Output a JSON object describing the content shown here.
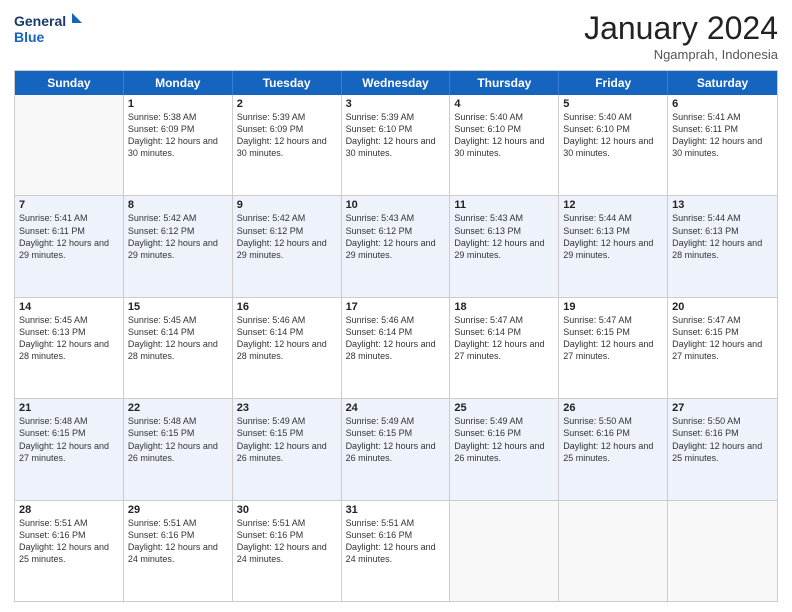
{
  "logo": {
    "line1": "General",
    "line2": "Blue"
  },
  "title": "January 2024",
  "subtitle": "Ngamprah, Indonesia",
  "days": [
    "Sunday",
    "Monday",
    "Tuesday",
    "Wednesday",
    "Thursday",
    "Friday",
    "Saturday"
  ],
  "rows": [
    [
      {
        "day": "",
        "sunrise": "",
        "sunset": "",
        "daylight": ""
      },
      {
        "day": "1",
        "sunrise": "Sunrise: 5:38 AM",
        "sunset": "Sunset: 6:09 PM",
        "daylight": "Daylight: 12 hours and 30 minutes."
      },
      {
        "day": "2",
        "sunrise": "Sunrise: 5:39 AM",
        "sunset": "Sunset: 6:09 PM",
        "daylight": "Daylight: 12 hours and 30 minutes."
      },
      {
        "day": "3",
        "sunrise": "Sunrise: 5:39 AM",
        "sunset": "Sunset: 6:10 PM",
        "daylight": "Daylight: 12 hours and 30 minutes."
      },
      {
        "day": "4",
        "sunrise": "Sunrise: 5:40 AM",
        "sunset": "Sunset: 6:10 PM",
        "daylight": "Daylight: 12 hours and 30 minutes."
      },
      {
        "day": "5",
        "sunrise": "Sunrise: 5:40 AM",
        "sunset": "Sunset: 6:10 PM",
        "daylight": "Daylight: 12 hours and 30 minutes."
      },
      {
        "day": "6",
        "sunrise": "Sunrise: 5:41 AM",
        "sunset": "Sunset: 6:11 PM",
        "daylight": "Daylight: 12 hours and 30 minutes."
      }
    ],
    [
      {
        "day": "7",
        "sunrise": "Sunrise: 5:41 AM",
        "sunset": "Sunset: 6:11 PM",
        "daylight": "Daylight: 12 hours and 29 minutes."
      },
      {
        "day": "8",
        "sunrise": "Sunrise: 5:42 AM",
        "sunset": "Sunset: 6:12 PM",
        "daylight": "Daylight: 12 hours and 29 minutes."
      },
      {
        "day": "9",
        "sunrise": "Sunrise: 5:42 AM",
        "sunset": "Sunset: 6:12 PM",
        "daylight": "Daylight: 12 hours and 29 minutes."
      },
      {
        "day": "10",
        "sunrise": "Sunrise: 5:43 AM",
        "sunset": "Sunset: 6:12 PM",
        "daylight": "Daylight: 12 hours and 29 minutes."
      },
      {
        "day": "11",
        "sunrise": "Sunrise: 5:43 AM",
        "sunset": "Sunset: 6:13 PM",
        "daylight": "Daylight: 12 hours and 29 minutes."
      },
      {
        "day": "12",
        "sunrise": "Sunrise: 5:44 AM",
        "sunset": "Sunset: 6:13 PM",
        "daylight": "Daylight: 12 hours and 29 minutes."
      },
      {
        "day": "13",
        "sunrise": "Sunrise: 5:44 AM",
        "sunset": "Sunset: 6:13 PM",
        "daylight": "Daylight: 12 hours and 28 minutes."
      }
    ],
    [
      {
        "day": "14",
        "sunrise": "Sunrise: 5:45 AM",
        "sunset": "Sunset: 6:13 PM",
        "daylight": "Daylight: 12 hours and 28 minutes."
      },
      {
        "day": "15",
        "sunrise": "Sunrise: 5:45 AM",
        "sunset": "Sunset: 6:14 PM",
        "daylight": "Daylight: 12 hours and 28 minutes."
      },
      {
        "day": "16",
        "sunrise": "Sunrise: 5:46 AM",
        "sunset": "Sunset: 6:14 PM",
        "daylight": "Daylight: 12 hours and 28 minutes."
      },
      {
        "day": "17",
        "sunrise": "Sunrise: 5:46 AM",
        "sunset": "Sunset: 6:14 PM",
        "daylight": "Daylight: 12 hours and 28 minutes."
      },
      {
        "day": "18",
        "sunrise": "Sunrise: 5:47 AM",
        "sunset": "Sunset: 6:14 PM",
        "daylight": "Daylight: 12 hours and 27 minutes."
      },
      {
        "day": "19",
        "sunrise": "Sunrise: 5:47 AM",
        "sunset": "Sunset: 6:15 PM",
        "daylight": "Daylight: 12 hours and 27 minutes."
      },
      {
        "day": "20",
        "sunrise": "Sunrise: 5:47 AM",
        "sunset": "Sunset: 6:15 PM",
        "daylight": "Daylight: 12 hours and 27 minutes."
      }
    ],
    [
      {
        "day": "21",
        "sunrise": "Sunrise: 5:48 AM",
        "sunset": "Sunset: 6:15 PM",
        "daylight": "Daylight: 12 hours and 27 minutes."
      },
      {
        "day": "22",
        "sunrise": "Sunrise: 5:48 AM",
        "sunset": "Sunset: 6:15 PM",
        "daylight": "Daylight: 12 hours and 26 minutes."
      },
      {
        "day": "23",
        "sunrise": "Sunrise: 5:49 AM",
        "sunset": "Sunset: 6:15 PM",
        "daylight": "Daylight: 12 hours and 26 minutes."
      },
      {
        "day": "24",
        "sunrise": "Sunrise: 5:49 AM",
        "sunset": "Sunset: 6:15 PM",
        "daylight": "Daylight: 12 hours and 26 minutes."
      },
      {
        "day": "25",
        "sunrise": "Sunrise: 5:49 AM",
        "sunset": "Sunset: 6:16 PM",
        "daylight": "Daylight: 12 hours and 26 minutes."
      },
      {
        "day": "26",
        "sunrise": "Sunrise: 5:50 AM",
        "sunset": "Sunset: 6:16 PM",
        "daylight": "Daylight: 12 hours and 25 minutes."
      },
      {
        "day": "27",
        "sunrise": "Sunrise: 5:50 AM",
        "sunset": "Sunset: 6:16 PM",
        "daylight": "Daylight: 12 hours and 25 minutes."
      }
    ],
    [
      {
        "day": "28",
        "sunrise": "Sunrise: 5:51 AM",
        "sunset": "Sunset: 6:16 PM",
        "daylight": "Daylight: 12 hours and 25 minutes."
      },
      {
        "day": "29",
        "sunrise": "Sunrise: 5:51 AM",
        "sunset": "Sunset: 6:16 PM",
        "daylight": "Daylight: 12 hours and 24 minutes."
      },
      {
        "day": "30",
        "sunrise": "Sunrise: 5:51 AM",
        "sunset": "Sunset: 6:16 PM",
        "daylight": "Daylight: 12 hours and 24 minutes."
      },
      {
        "day": "31",
        "sunrise": "Sunrise: 5:51 AM",
        "sunset": "Sunset: 6:16 PM",
        "daylight": "Daylight: 12 hours and 24 minutes."
      },
      {
        "day": "",
        "sunrise": "",
        "sunset": "",
        "daylight": ""
      },
      {
        "day": "",
        "sunrise": "",
        "sunset": "",
        "daylight": ""
      },
      {
        "day": "",
        "sunrise": "",
        "sunset": "",
        "daylight": ""
      }
    ]
  ]
}
